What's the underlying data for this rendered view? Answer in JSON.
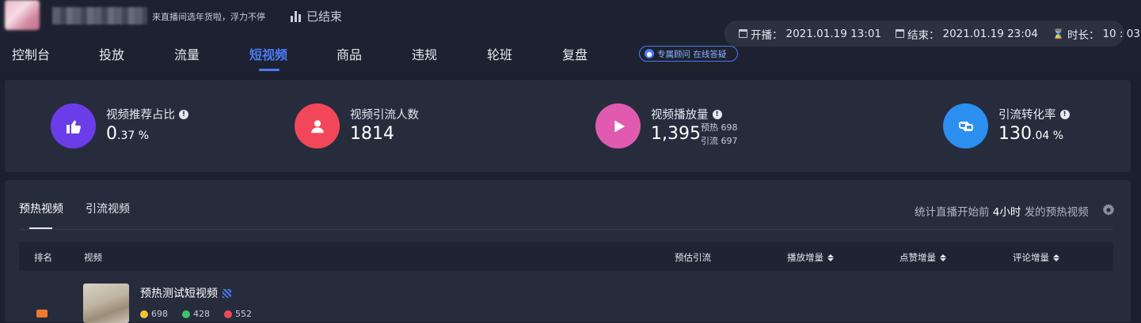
{
  "header": {
    "live_title": "来直播间选年货啦，浮力不停",
    "status": "已结束",
    "start_label": "开播：",
    "start_value": "2021.01.19 13:01",
    "end_label": "结束：",
    "end_value": "2021.01.19 23:04",
    "duration_label": "时长：",
    "duration_value": "10 : 03"
  },
  "nav": {
    "tabs": [
      {
        "label": "控制台"
      },
      {
        "label": "投放"
      },
      {
        "label": "流量"
      },
      {
        "label": "短视频"
      },
      {
        "label": "商品"
      },
      {
        "label": "违规"
      },
      {
        "label": "轮班"
      },
      {
        "label": "复盘"
      }
    ],
    "active_index": 3,
    "advisor_label": "专属顾问 在线答疑"
  },
  "stats": [
    {
      "label": "视频推荐占比",
      "value_main": "0",
      "value_small": ".37 %",
      "color": "#6b3de8"
    },
    {
      "label": "视频引流人数",
      "value_main": "1814",
      "value_small": "",
      "color": "#f2475a"
    },
    {
      "label": "视频播放量",
      "value_main": "1,395",
      "value_small": "",
      "color": "#e05bb0",
      "sub": [
        {
          "label": "预热",
          "value": "698"
        },
        {
          "label": "引流",
          "value": "697"
        }
      ]
    },
    {
      "label": "引流转化率",
      "value_main": "130",
      "value_small": ".04 %",
      "color": "#2b8ff0"
    }
  ],
  "content": {
    "tabs": [
      {
        "label": "预热视频"
      },
      {
        "label": "引流视频"
      }
    ],
    "active_tab": 0,
    "note_prefix": "统计直播开始前",
    "note_highlight": "4小时",
    "note_suffix": "发的预热视频",
    "columns": [
      {
        "label": "排名"
      },
      {
        "label": "视频"
      },
      {
        "label": "预估引流"
      },
      {
        "label": "播放增量"
      },
      {
        "label": "点赞增量"
      },
      {
        "label": "评论增量"
      }
    ],
    "rows": [
      {
        "title": "预热测试短视频",
        "plays": "698",
        "likes": "428",
        "comments": "552"
      }
    ]
  }
}
